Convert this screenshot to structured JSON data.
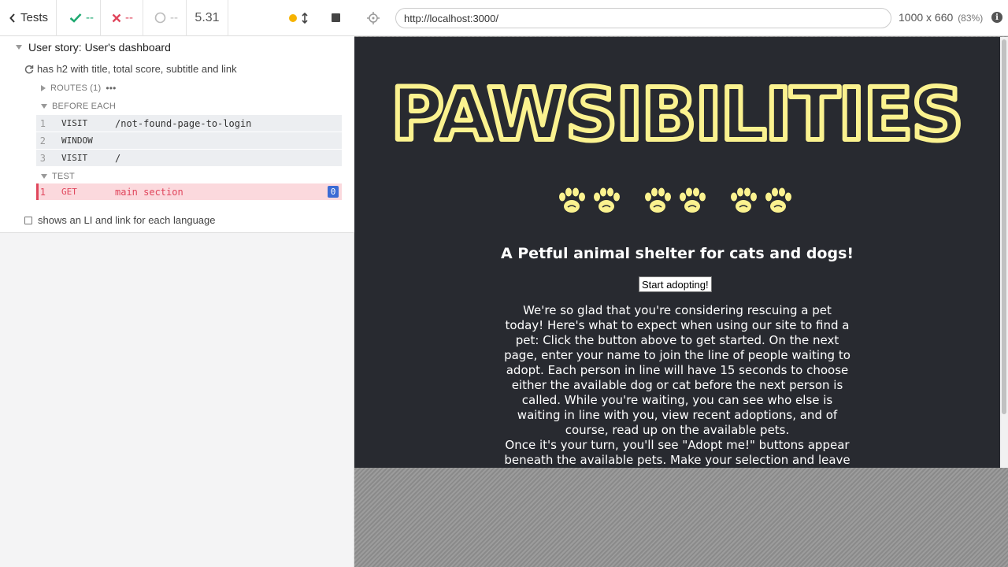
{
  "runner": {
    "back_label": "Tests",
    "passed": "--",
    "failed": "--",
    "pending": "--",
    "duration": "5.31",
    "suite_title": "User story: User's dashboard",
    "test_running": "has h2 with title, total score, subtitle and link",
    "routes_label": "ROUTES (1)",
    "before_each_label": "BEFORE EACH",
    "test_label": "TEST",
    "commands": [
      {
        "num": "1",
        "name": "VISIT",
        "msg": "/not-found-page-to-login"
      },
      {
        "num": "2",
        "name": "WINDOW",
        "msg": ""
      },
      {
        "num": "3",
        "name": "VISIT",
        "msg": "/"
      }
    ],
    "failed_command": {
      "num": "1",
      "name": "GET",
      "msg": "main section",
      "count": "0"
    },
    "test_pending": "shows an LI and link for each language"
  },
  "browser": {
    "url": "http://localhost:3000/",
    "viewport": "1000 x 660",
    "zoom": "(83%)"
  },
  "app": {
    "logo_text": "PAWSIBILITIES",
    "subtitle": "A Petful animal shelter for cats and dogs!",
    "start_button": "Start adopting!",
    "intro_lines": [
      "We're so glad that you're considering rescuing a pet today! Here's what to expect when using our site to find a pet: Click the button above to get started. On the next page, enter your name to join the line of people waiting to adopt. Each person in line will have 15 seconds to choose either the available dog or cat before the next person is called. While you're waiting, you can see who else is waiting in line with you, view recent adoptions, and of course, read up on the available pets.",
      "Once it's your turn, you'll see \"Adopt me!\" buttons appear beneath the available pets. Make your selection and leave"
    ]
  },
  "colors": {
    "app_background": "#282a30",
    "logo_yellow": "#fbf28f",
    "fail_red": "#e0465c",
    "pass_green": "#1fa971"
  }
}
